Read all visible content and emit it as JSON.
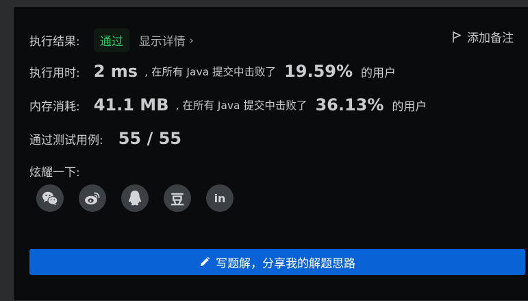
{
  "result": {
    "label": "执行结果:",
    "status": "通过",
    "details": "显示详情",
    "details_chevron": "›"
  },
  "add_note": "添加备注",
  "runtime": {
    "label": "执行用时:",
    "value": "2 ms",
    "middle": ", 在所有 Java 提交中击败了",
    "percent": "19.59%",
    "suffix": "的用户"
  },
  "memory": {
    "label": "内存消耗:",
    "value": "41.1 MB",
    "middle": ", 在所有 Java 提交中击败了",
    "percent": "36.13%",
    "suffix": "的用户"
  },
  "tests": {
    "label": "通过测试用例:",
    "value": "55 / 55"
  },
  "share": {
    "label": "炫耀一下:",
    "icons": [
      "wechat-icon",
      "weibo-icon",
      "qq-icon",
      "douban-icon",
      "linkedin-icon"
    ],
    "douban_glyph": "豆",
    "linkedin_glyph": "in"
  },
  "write_solution": "写题解，分享我的解题思路",
  "colors": {
    "pass": "#2ec66b",
    "button": "#0a63d6",
    "panel": "#0a0b0c"
  }
}
